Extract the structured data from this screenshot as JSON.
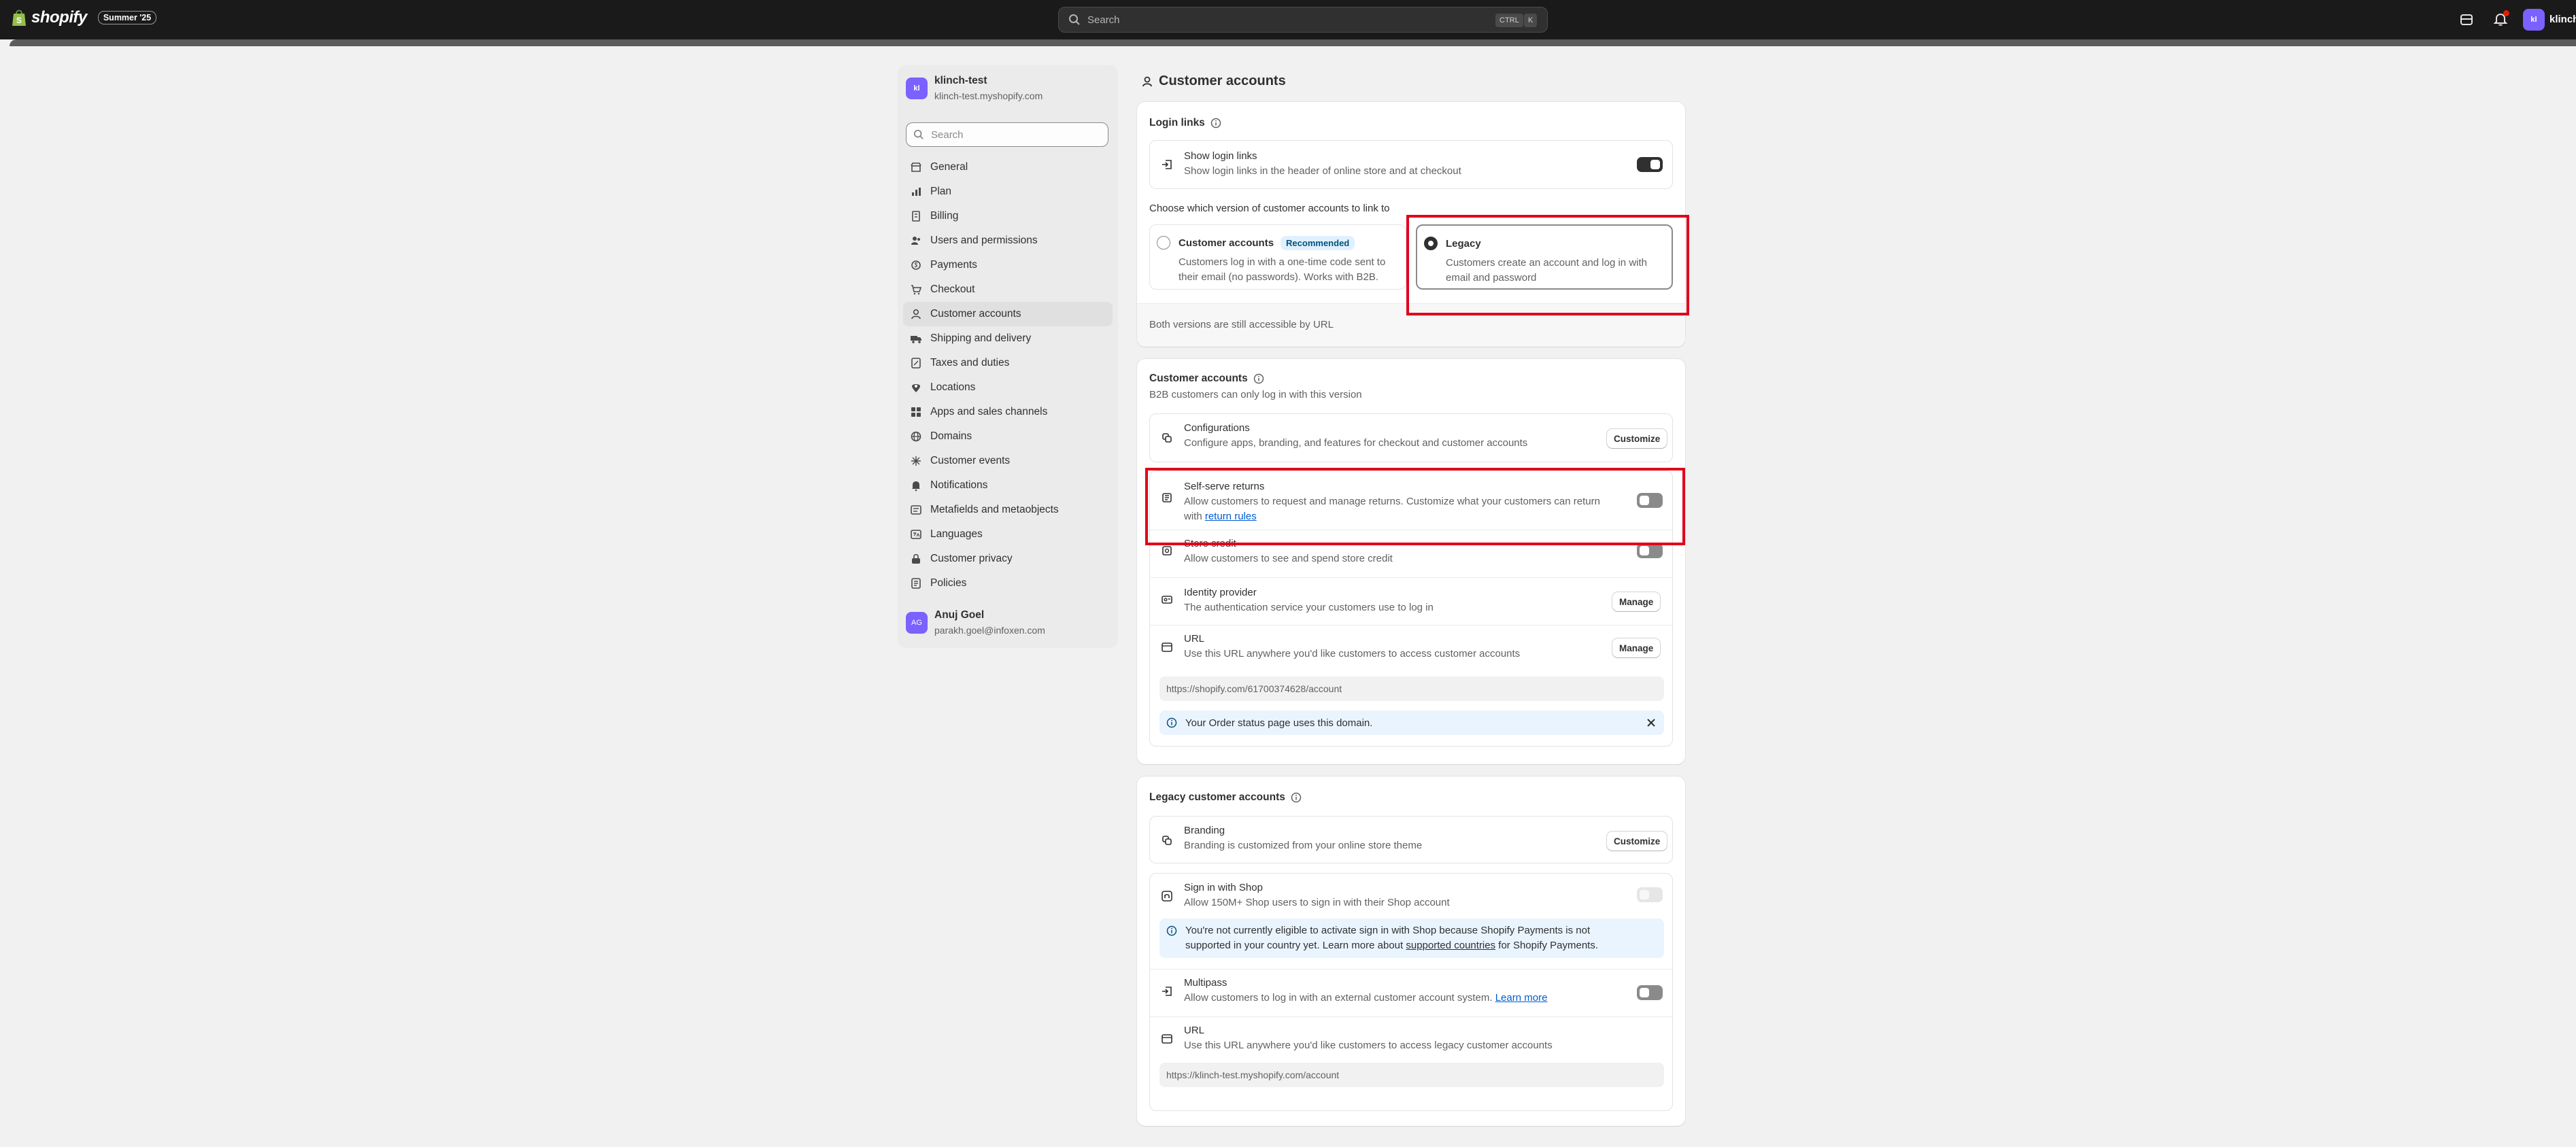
{
  "topbar": {
    "brand": "shopify",
    "edition": "Summer '25",
    "search_placeholder": "Search",
    "shortcut_ctrl": "CTRL",
    "shortcut_k": "K",
    "store_initials": "kl",
    "store_name": "klinch"
  },
  "sidebar": {
    "store_initials": "kl",
    "store_name": "klinch-test",
    "store_url": "klinch-test.myshopify.com",
    "search_placeholder": "Search",
    "items": [
      {
        "label": "General",
        "icon": "store-icon"
      },
      {
        "label": "Plan",
        "icon": "chart-icon"
      },
      {
        "label": "Billing",
        "icon": "receipt-icon"
      },
      {
        "label": "Users and permissions",
        "icon": "users-icon"
      },
      {
        "label": "Payments",
        "icon": "payments-icon"
      },
      {
        "label": "Checkout",
        "icon": "cart-icon"
      },
      {
        "label": "Customer accounts",
        "icon": "person-icon"
      },
      {
        "label": "Shipping and delivery",
        "icon": "truck-icon"
      },
      {
        "label": "Taxes and duties",
        "icon": "tax-icon"
      },
      {
        "label": "Locations",
        "icon": "location-icon"
      },
      {
        "label": "Apps and sales channels",
        "icon": "apps-icon"
      },
      {
        "label": "Domains",
        "icon": "globe-icon"
      },
      {
        "label": "Customer events",
        "icon": "events-icon"
      },
      {
        "label": "Notifications",
        "icon": "bell-icon"
      },
      {
        "label": "Metafields and metaobjects",
        "icon": "metafields-icon"
      },
      {
        "label": "Languages",
        "icon": "language-icon"
      },
      {
        "label": "Customer privacy",
        "icon": "lock-icon"
      },
      {
        "label": "Policies",
        "icon": "policy-icon"
      }
    ],
    "active_index": 6,
    "user_initials": "AG",
    "user_name": "Anuj Goel",
    "user_email": "parakh.goel@infoxen.com"
  },
  "page": {
    "title": "Customer accounts"
  },
  "login_links": {
    "title": "Login links",
    "show_title": "Show login links",
    "show_desc": "Show login links in the header of online store and at checkout",
    "show_on": true,
    "choose_text": "Choose which version of customer accounts to link to",
    "option_new_title": "Customer accounts",
    "option_new_badge": "Recommended",
    "option_new_desc_1": "Customers log in with a one-time code sent to",
    "option_new_desc_2": "their email (no passwords). Works with B2B.",
    "option_legacy_title": "Legacy",
    "option_legacy_desc_1": "Customers create an account and log in with",
    "option_legacy_desc_2": "email and password",
    "selected": "legacy",
    "footer_note": "Both versions are still accessible by URL"
  },
  "customer_accounts": {
    "title": "Customer accounts",
    "subtitle": "B2B customers can only log in with this version",
    "config_title": "Configurations",
    "config_desc": "Configure apps, branding, and features for checkout and customer accounts",
    "config_btn": "Customize",
    "returns_title": "Self-serve returns",
    "returns_desc_1": "Allow customers to request and manage returns. Customize what your customers can return",
    "returns_desc_2_prefix": "with ",
    "returns_link": "return rules",
    "returns_on": false,
    "credit_title": "Store credit",
    "credit_desc": "Allow customers to see and spend store credit",
    "credit_on": false,
    "idp_title": "Identity provider",
    "idp_desc": "The authentication service your customers use to log in",
    "idp_btn": "Manage",
    "url_title": "URL",
    "url_desc": "Use this URL anywhere you'd like customers to access customer accounts",
    "url_btn": "Manage",
    "url_value": "https://shopify.com/61700374628/account",
    "banner_text": "Your Order status page uses this domain."
  },
  "legacy_accounts": {
    "title": "Legacy customer accounts",
    "branding_title": "Branding",
    "branding_desc": "Branding is customized from your online store theme",
    "branding_btn": "Customize",
    "shop_title": "Sign in with Shop",
    "shop_desc": "Allow 150M+ Shop users to sign in with their Shop account",
    "shop_banner_1": "You're not currently eligible to activate sign in with Shop because Shopify Payments is not",
    "shop_banner_2_prefix": "supported in your country yet. Learn more about ",
    "shop_banner_link": "supported countries",
    "shop_banner_2_suffix": " for Shopify Payments.",
    "multipass_title": "Multipass",
    "multipass_desc_prefix": "Allow customers to log in with an external customer account system. ",
    "multipass_link": "Learn more",
    "multipass_on": false,
    "url_title": "URL",
    "url_desc": "Use this URL anywhere you'd like customers to access legacy customer accounts",
    "url_value": "https://klinch-test.myshopify.com/account"
  }
}
